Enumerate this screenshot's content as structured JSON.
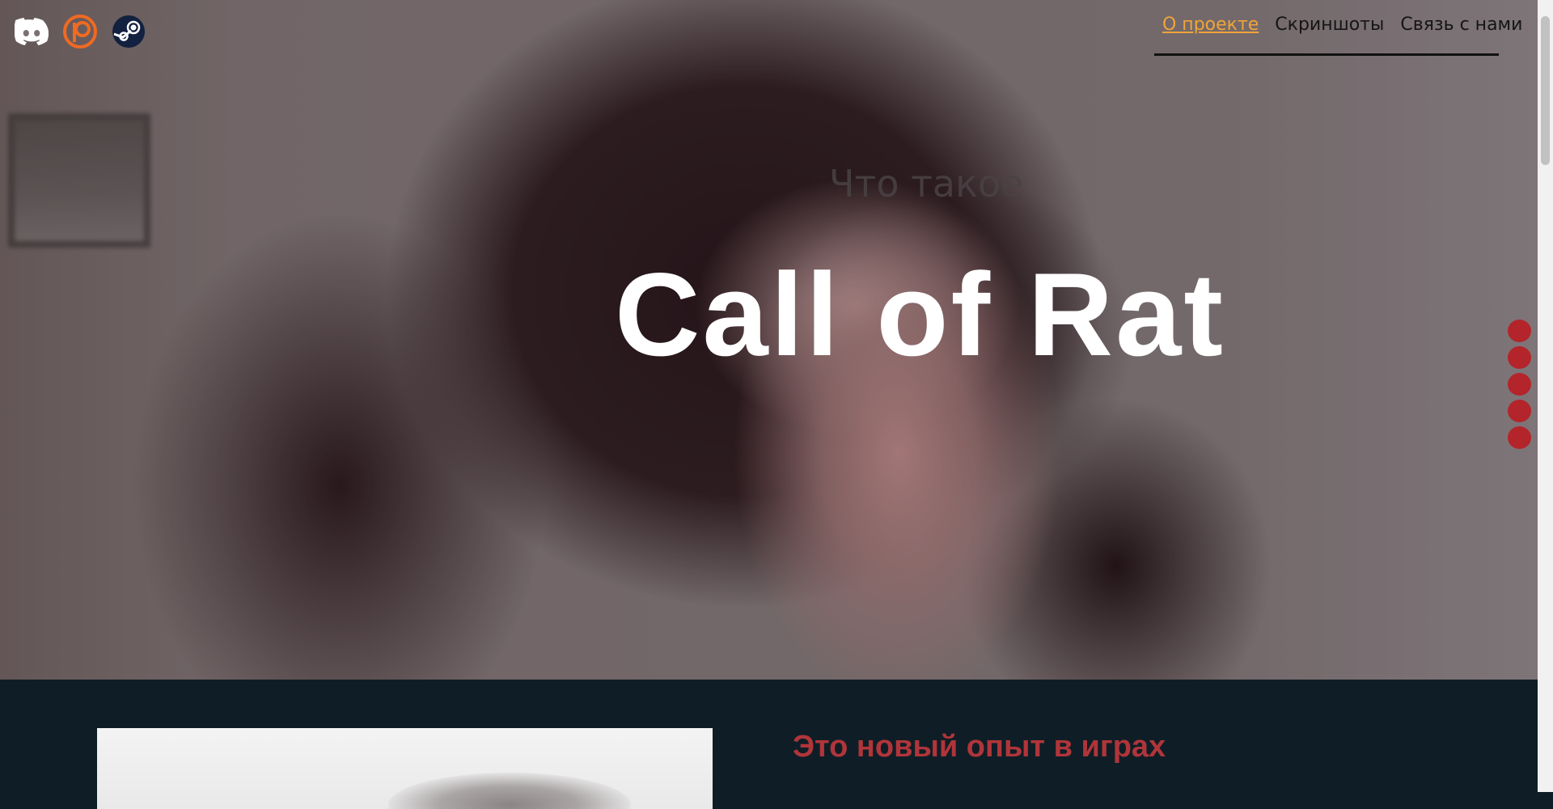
{
  "socials": [
    {
      "name": "discord-icon",
      "color": "#ffffff"
    },
    {
      "name": "patreon-icon",
      "color": "#f06a22"
    },
    {
      "name": "steam-icon",
      "color": "#0f1e3a"
    }
  ],
  "nav": {
    "items": [
      {
        "label": "О проекте",
        "active": true
      },
      {
        "label": "Скриншоты",
        "active": false
      },
      {
        "label": "Связь с нами",
        "active": false
      }
    ],
    "active_color": "#f0a43a"
  },
  "hero": {
    "eyebrow": "Что такое",
    "title": "Call of Rat"
  },
  "side_dots": {
    "count": 5,
    "color": "#b4242b"
  },
  "about": {
    "heading": "Это новый опыт в играх"
  }
}
